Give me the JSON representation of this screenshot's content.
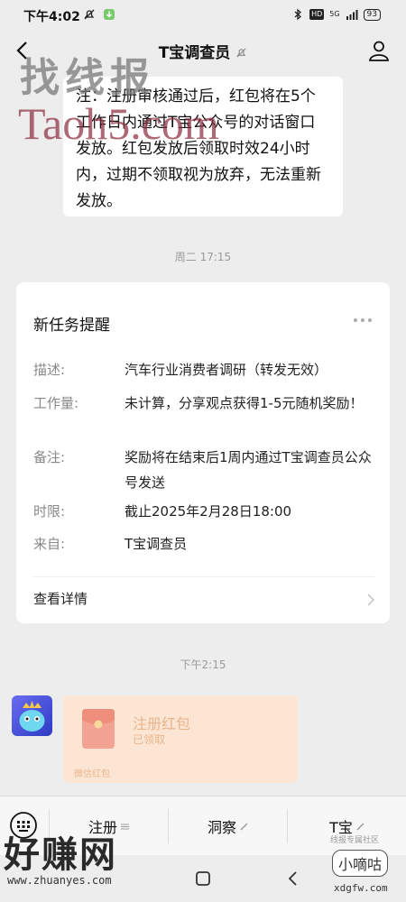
{
  "status_bar": {
    "time": "下午4:02",
    "network": "5G",
    "battery": "93"
  },
  "nav": {
    "title": "T宝调查员"
  },
  "messages": {
    "notice_text": "注：注册审核通过后，红包将在5个工作日内通过T宝公众号的对话窗口发放。红包发放后领取时效24小时内，过期不领取视为放弃，无法重新发放。",
    "timestamp_1": "周二 17:15",
    "timestamp_2": "下午2:15"
  },
  "task_card": {
    "title": "新任务提醒",
    "rows": [
      {
        "key": "描述:",
        "value": "汽车行业消费者调研（转发无效）"
      },
      {
        "key": "工作量:",
        "value": "未计算，分享观点获得1-5元随机奖励！"
      },
      {
        "key": "备注:",
        "value": "奖励将在结束后1周内通过T宝调查员公众号发送"
      },
      {
        "key": "时限:",
        "value": "截止2025年2月28日18:00"
      },
      {
        "key": "来自:",
        "value": "T宝调查员"
      }
    ],
    "link": "查看详情"
  },
  "red_packet": {
    "title": "注册红包",
    "status": "已领取",
    "footer": "微信红包"
  },
  "menu": {
    "items": [
      "注册",
      "洞察",
      "T宝"
    ]
  },
  "watermarks": {
    "top_text": "找线报",
    "top_url": "Taoh5.com",
    "bottom_left": "好赚网",
    "bottom_left_url": "www.zhuanyes.com",
    "bottom_right": "小嘀咕",
    "bottom_right_url": "xdgfw.com",
    "bottom_right_small": "线报专属社区"
  },
  "colors": {
    "background": "#ededed",
    "card": "#ffffff",
    "packet": "#fce6d3",
    "packet_text": "#e8b48e",
    "watermark_red": "#8a2a3c"
  }
}
